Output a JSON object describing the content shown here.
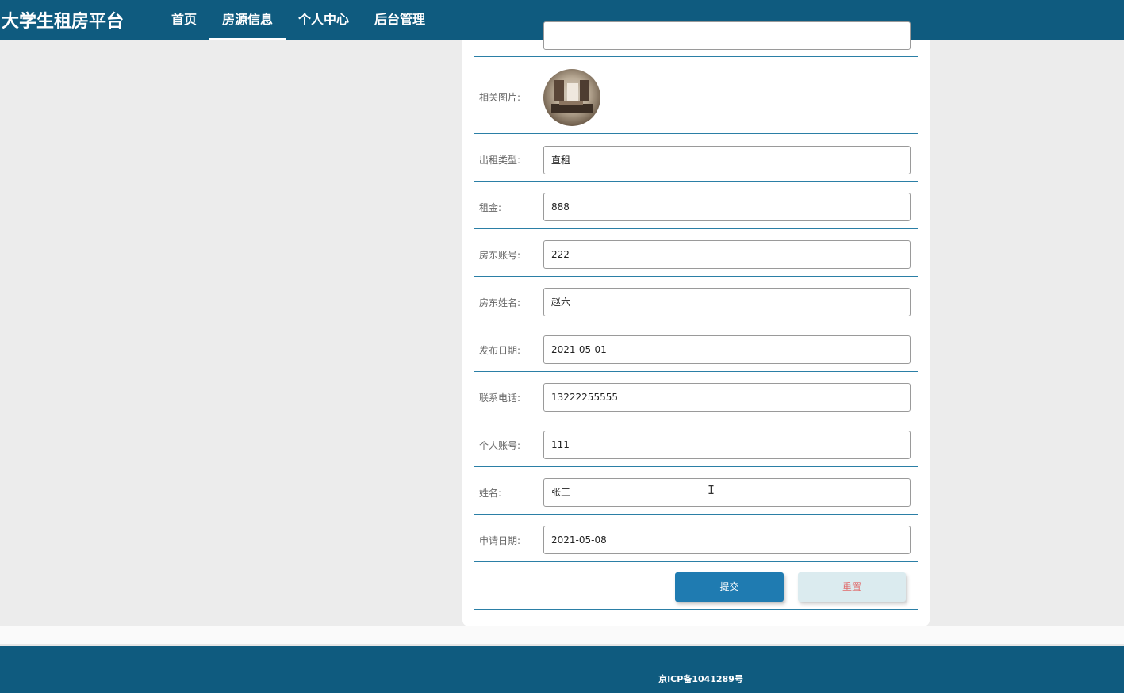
{
  "header": {
    "brand": "大学生租房平台",
    "nav": [
      {
        "label": "首页",
        "active": false
      },
      {
        "label": "房源信息",
        "active": true
      },
      {
        "label": "个人中心",
        "active": false
      },
      {
        "label": "后台管理",
        "active": false
      }
    ]
  },
  "form": {
    "image_label": "相关图片:",
    "fields": [
      {
        "label": "出租类型:",
        "value": "直租"
      },
      {
        "label": "租金:",
        "value": "888"
      },
      {
        "label": "房东账号:",
        "value": "222"
      },
      {
        "label": "房东姓名:",
        "value": "赵六"
      },
      {
        "label": "发布日期:",
        "value": "2021-05-01"
      },
      {
        "label": "联系电话:",
        "value": "13222255555"
      },
      {
        "label": "个人账号:",
        "value": "111"
      },
      {
        "label": "姓名:",
        "value": "张三"
      },
      {
        "label": "申请日期:",
        "value": "2021-05-08"
      }
    ],
    "submit_label": "提交",
    "reset_label": "重置"
  },
  "footer": {
    "icp": "京ICP备1041289号"
  },
  "colors": {
    "brand": "#0f5b7f",
    "accent": "#1f7bb1",
    "divider": "#2b7fa6"
  }
}
